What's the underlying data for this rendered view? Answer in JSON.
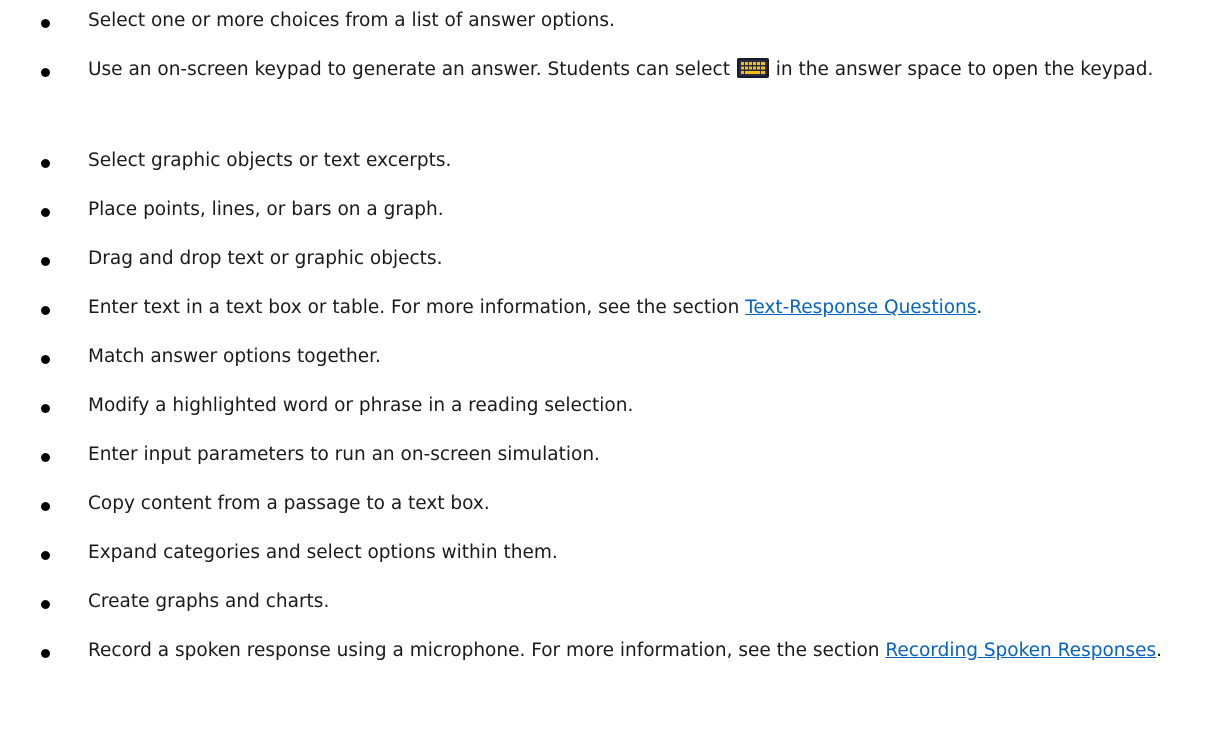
{
  "items": [
    {
      "text": "Select one or more choices from a list of answer options."
    },
    {
      "before": "Use an on-screen keypad to generate an answer. Students can select ",
      "icon": "keyboard-icon",
      "after": " in the answer space to open the keypad."
    },
    {
      "text": "Select graphic objects or text excerpts."
    },
    {
      "text": "Place points, lines, or bars on a graph."
    },
    {
      "text": "Drag and drop text or graphic objects."
    },
    {
      "before": "Enter text in a text box or table. For more information, see the section ",
      "link": "Text-Response Questions",
      "after": "."
    },
    {
      "text": "Match answer options together."
    },
    {
      "text": "Modify a highlighted word or phrase in a reading selection."
    },
    {
      "text": "Enter input parameters to run an on-screen simulation."
    },
    {
      "text": "Copy content from a passage to a text box."
    },
    {
      "text": "Expand categories and select options within them."
    },
    {
      "text": "Create graphs and charts."
    },
    {
      "before": "Record a spoken response using a microphone. For more information, see the section ",
      "link": "Recording Spoken Responses",
      "after": "."
    }
  ],
  "colors": {
    "text": "#1a1a1a",
    "link": "#0563c1",
    "icon_bg": "#1a1a2e",
    "icon_keys": "#f2c200"
  }
}
